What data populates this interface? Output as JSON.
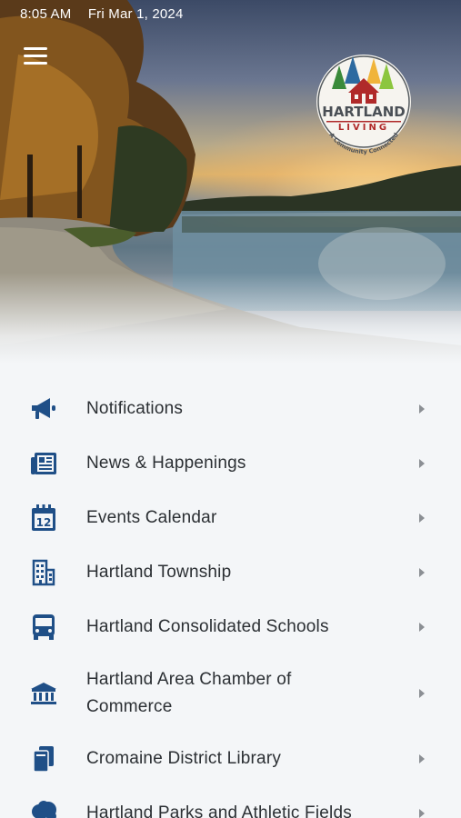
{
  "status_bar": {
    "time": "8:05 AM",
    "date": "Fri Mar 1, 2024"
  },
  "logo": {
    "brand": "HARTLAND",
    "sub": "LIVING",
    "tagline": "A Community Connected"
  },
  "colors": {
    "icon_blue": "#1f4f87",
    "text": "#2b2f33",
    "chevron": "#8b8f94"
  },
  "menu": [
    {
      "label": "Notifications",
      "icon": "megaphone-icon"
    },
    {
      "label": "News & Happenings",
      "icon": "newspaper-icon"
    },
    {
      "label": "Events Calendar",
      "icon": "calendar-icon",
      "icon_text": "12"
    },
    {
      "label": "Hartland Township",
      "icon": "building-icon"
    },
    {
      "label": "Hartland Consolidated Schools",
      "icon": "school-bus-icon"
    },
    {
      "label": "Hartland Area Chamber of Commerce",
      "icon": "bank-icon"
    },
    {
      "label": "Cromaine District Library",
      "icon": "books-icon"
    },
    {
      "label": "Hartland Parks and Athletic Fields",
      "icon": "tree-icon"
    }
  ]
}
